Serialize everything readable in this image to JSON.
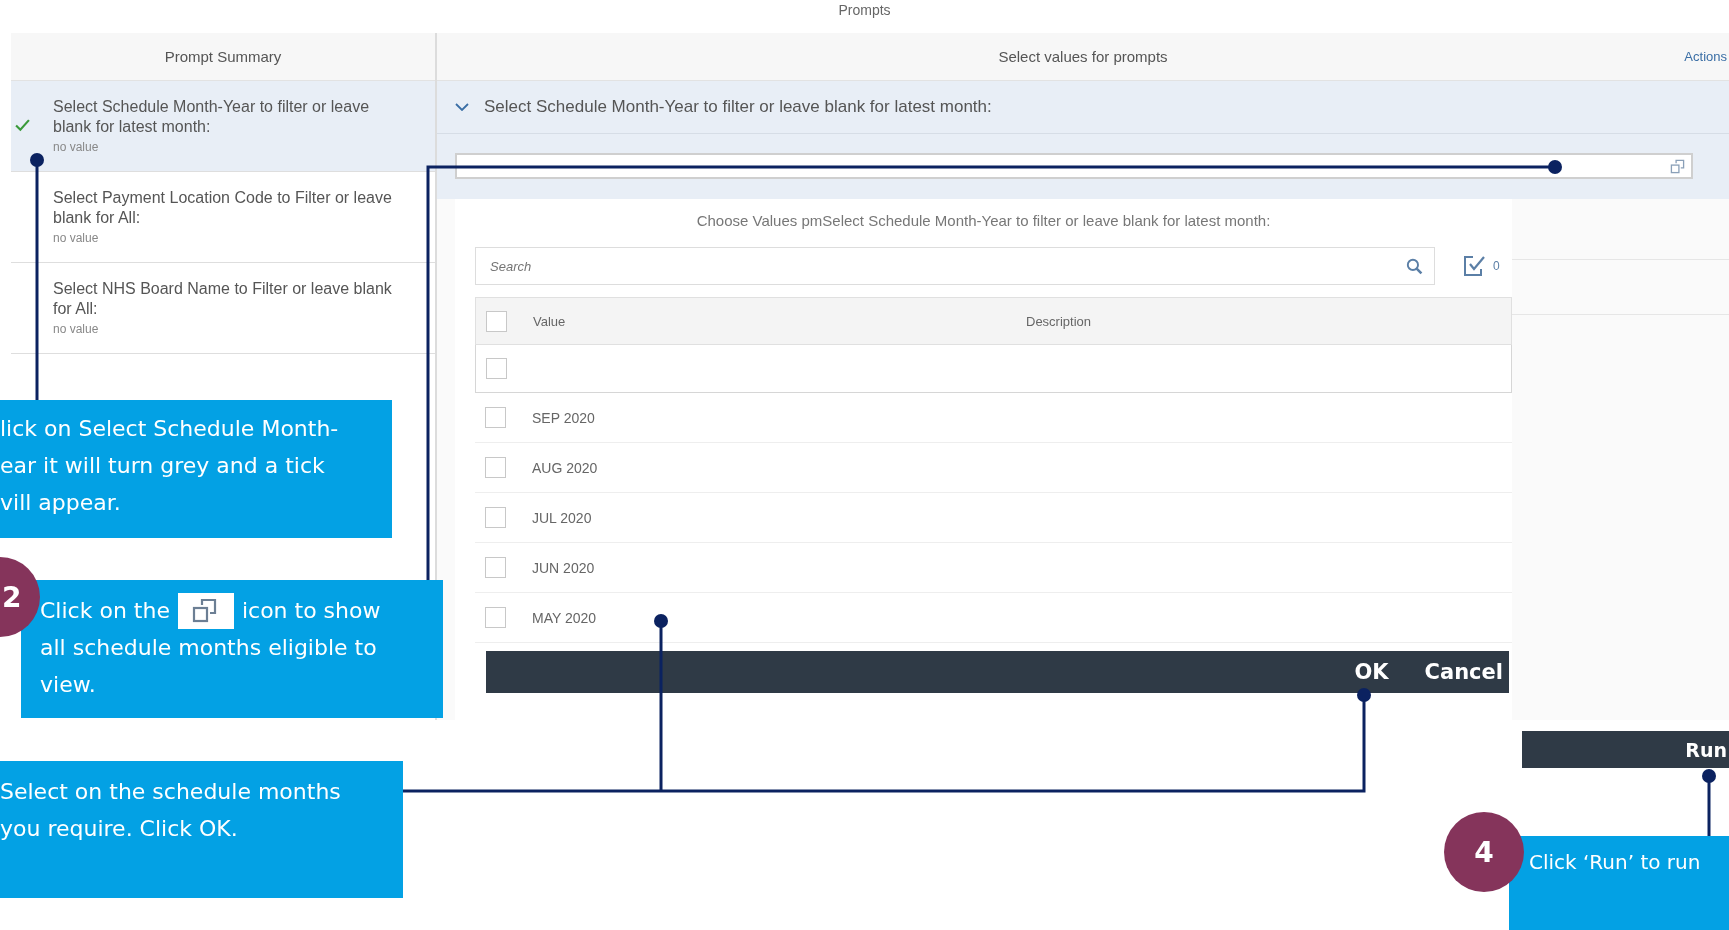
{
  "title": "Prompts",
  "summary": {
    "header": "Prompt Summary",
    "items": [
      {
        "label": "Select Schedule Month-Year to filter or leave blank for latest month:",
        "value": "no value",
        "selected": true,
        "done": true
      },
      {
        "label": "Select Payment Location Code to Filter or leave blank for All:",
        "value": "no value",
        "selected": false,
        "done": false
      },
      {
        "label": "Select NHS Board Name to Filter or leave blank for All:",
        "value": "no value",
        "selected": false,
        "done": false
      }
    ]
  },
  "values_panel": {
    "header": "Select values for prompts",
    "actions": "Actions",
    "prompt_title": "Select Schedule Month-Year to filter or leave blank for latest month:",
    "expanded": true
  },
  "dialog": {
    "title": "Choose Values pmSelect Schedule Month-Year to filter or leave blank for latest month:",
    "search_placeholder": "Search",
    "selected_count": "0",
    "all_selected": false,
    "columns": [
      "Value",
      "Description"
    ],
    "rows": [
      {
        "value": "",
        "checked": false
      },
      {
        "value": "SEP 2020",
        "checked": false
      },
      {
        "value": "AUG 2020",
        "checked": false
      },
      {
        "value": "JUL 2020",
        "checked": false
      },
      {
        "value": "JUN 2020",
        "checked": false
      },
      {
        "value": "MAY 2020",
        "checked": false
      }
    ],
    "buttons": [
      "OK",
      "Cancel"
    ]
  },
  "run_button": "Run",
  "callouts": [
    {
      "kind": "text",
      "lines": [
        "lick on Select Schedule Month-",
        "ear it will turn grey and a tick",
        "vill appear."
      ]
    },
    {
      "kind": "icon_text",
      "number": "2",
      "before": "Click on the",
      "after": "icon to show",
      "rest": "all schedule months eligible to view."
    },
    {
      "kind": "text",
      "lines": [
        "Select on the schedule months",
        "you require. Click OK."
      ]
    },
    {
      "kind": "text",
      "number": "4",
      "lines": [
        "Click ‘Run’ to run"
      ]
    }
  ]
}
